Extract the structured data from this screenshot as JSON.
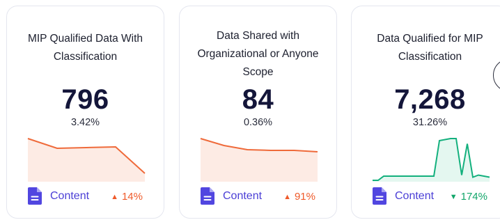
{
  "cards": [
    {
      "title": "MIP Qualified Data With Classification",
      "value": "796",
      "percent": "3.42%",
      "footer_label": "Content",
      "trend_direction": "up",
      "trend_arrow": "▲",
      "trend_value": "14%",
      "sparkline_color": "#ef6a3a",
      "sparkline_fill": "#fde6dd",
      "sparkline_values": [
        60,
        46,
        47,
        48,
        10
      ]
    },
    {
      "title": "Data Shared with Organizational or Anyone Scope",
      "value": "84",
      "percent": "0.36%",
      "footer_label": "Content",
      "trend_direction": "up",
      "trend_arrow": "▲",
      "trend_value": "91%",
      "sparkline_color": "#ef6a3a",
      "sparkline_fill": "#fde6dd",
      "sparkline_values": [
        60,
        50,
        44,
        43,
        43,
        41
      ]
    },
    {
      "title": "Data Qualified for MIP Classification",
      "value": "7,268",
      "percent": "31.26%",
      "footer_label": "Content",
      "trend_direction": "down",
      "trend_arrow": "▼",
      "trend_value": "174%",
      "sparkline_color": "#13b07d",
      "sparkline_fill": "#ddf5ec",
      "sparkline_values": [
        0,
        0,
        4,
        4,
        4,
        4,
        4,
        4,
        4,
        4,
        4,
        4,
        38,
        39,
        40,
        40,
        5,
        35,
        3,
        5,
        4,
        3
      ]
    }
  ],
  "colors": {
    "title_text": "#1c1f2e",
    "value_text": "#14163a",
    "footer_accent": "#4b3fd6",
    "trend_up": "#ef5a2a",
    "trend_down": "#12a66a"
  },
  "icons": {
    "footer_icon": "document-icon",
    "trend_up_icon": "triangle-up-icon",
    "trend_down_icon": "triangle-down-icon"
  }
}
